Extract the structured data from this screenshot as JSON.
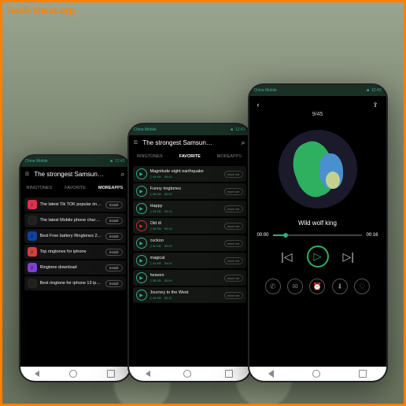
{
  "watermark": "hack-cheat.org",
  "statusbar": {
    "carrier": "China Mobile",
    "battery": "■",
    "time": "12:43"
  },
  "app": {
    "title": "The strongest Samsun…"
  },
  "tabs": {
    "ringtones": "RINGTONES",
    "favorite": "FAVORITE",
    "moreapps": "MOREAPPS"
  },
  "phone1": {
    "items": [
      {
        "title": "The latest Tik TOK popular ring…",
        "btn": "install",
        "color": "#e03050"
      },
      {
        "title": "The latest Mobile phone chargi…",
        "btn": "install",
        "color": "#222"
      },
      {
        "title": "Best Free battery Ringtones 20…",
        "btn": "install",
        "color": "#1040a0"
      },
      {
        "title": "Top ringtones for iphone",
        "btn": "install",
        "color": "#d04040"
      },
      {
        "title": "Ringtone download",
        "btn": "install",
        "color": "#8040d0"
      },
      {
        "title": "Best ringtone for iphone 13 iph…",
        "btn": "install",
        "color": "#222"
      }
    ]
  },
  "phone2": {
    "items": [
      {
        "title": "Magnitude eight earthquake",
        "size": "43 KB",
        "dur": "00:10",
        "btn": "more set"
      },
      {
        "title": "Funny ringtones",
        "size": "38 KB",
        "dur": "00:09",
        "btn": "more set"
      },
      {
        "title": "Happy",
        "size": "43 KB",
        "dur": "00:14",
        "btn": "more set"
      },
      {
        "title": "Old di",
        "size": "45 KB",
        "dur": "00:10",
        "btn": "more set"
      },
      {
        "title": "cuckoo",
        "size": "42 KB",
        "dur": "00:20",
        "btn": "more set"
      },
      {
        "title": "magical",
        "size": "41 KB",
        "dur": "00:10",
        "btn": "more set"
      },
      {
        "title": "heaven",
        "size": "38 KB",
        "dur": "00:09",
        "btn": "more set"
      },
      {
        "title": "Journey to the West",
        "size": "44 KB",
        "dur": "00:11",
        "btn": "more set"
      }
    ]
  },
  "player": {
    "counter": "9/45",
    "track": "Wild wolf king",
    "current": "00:00",
    "total": "00:16"
  }
}
